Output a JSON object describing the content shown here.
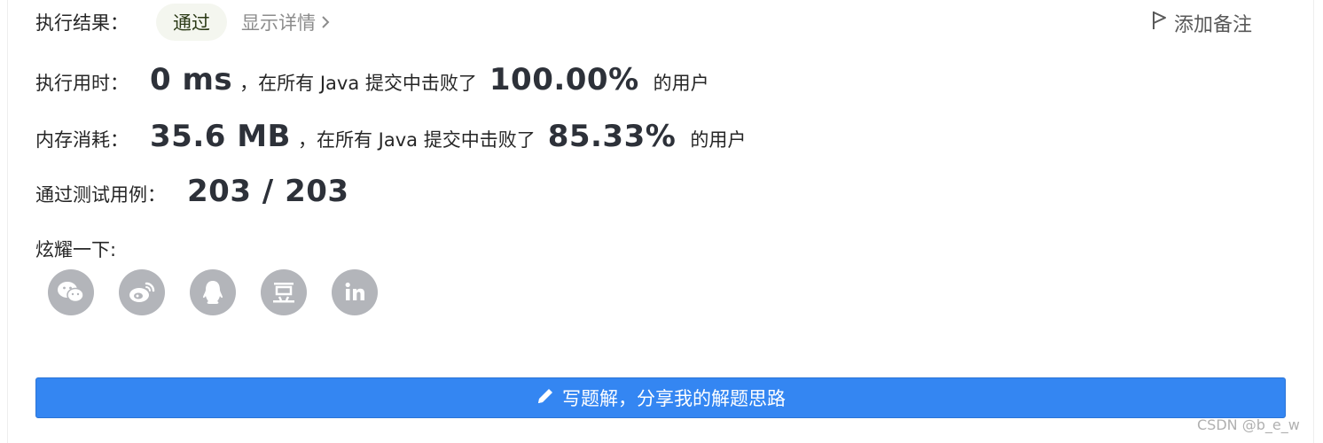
{
  "result": {
    "label": "执行结果：",
    "status": "通过",
    "details_link": "显示详情",
    "add_note": "添加备注"
  },
  "runtime": {
    "label": "执行用时：",
    "value": "0 ms",
    "mid_text": "，在所有 Java 提交中击败了",
    "percent": "100.00%",
    "suffix": "的用户"
  },
  "memory": {
    "label": "内存消耗：",
    "value": "35.6 MB",
    "mid_text": "，在所有 Java 提交中击败了",
    "percent": "85.33%",
    "suffix": "的用户"
  },
  "tests": {
    "label": "通过测试用例：",
    "value": "203 / 203"
  },
  "share": {
    "label": "炫耀一下:",
    "icons": [
      "wechat-icon",
      "weibo-icon",
      "qq-icon",
      "douban-icon",
      "linkedin-icon"
    ]
  },
  "write_button": {
    "label": "写题解，分享我的解题思路"
  },
  "watermark": "CSDN @b_e_w"
}
